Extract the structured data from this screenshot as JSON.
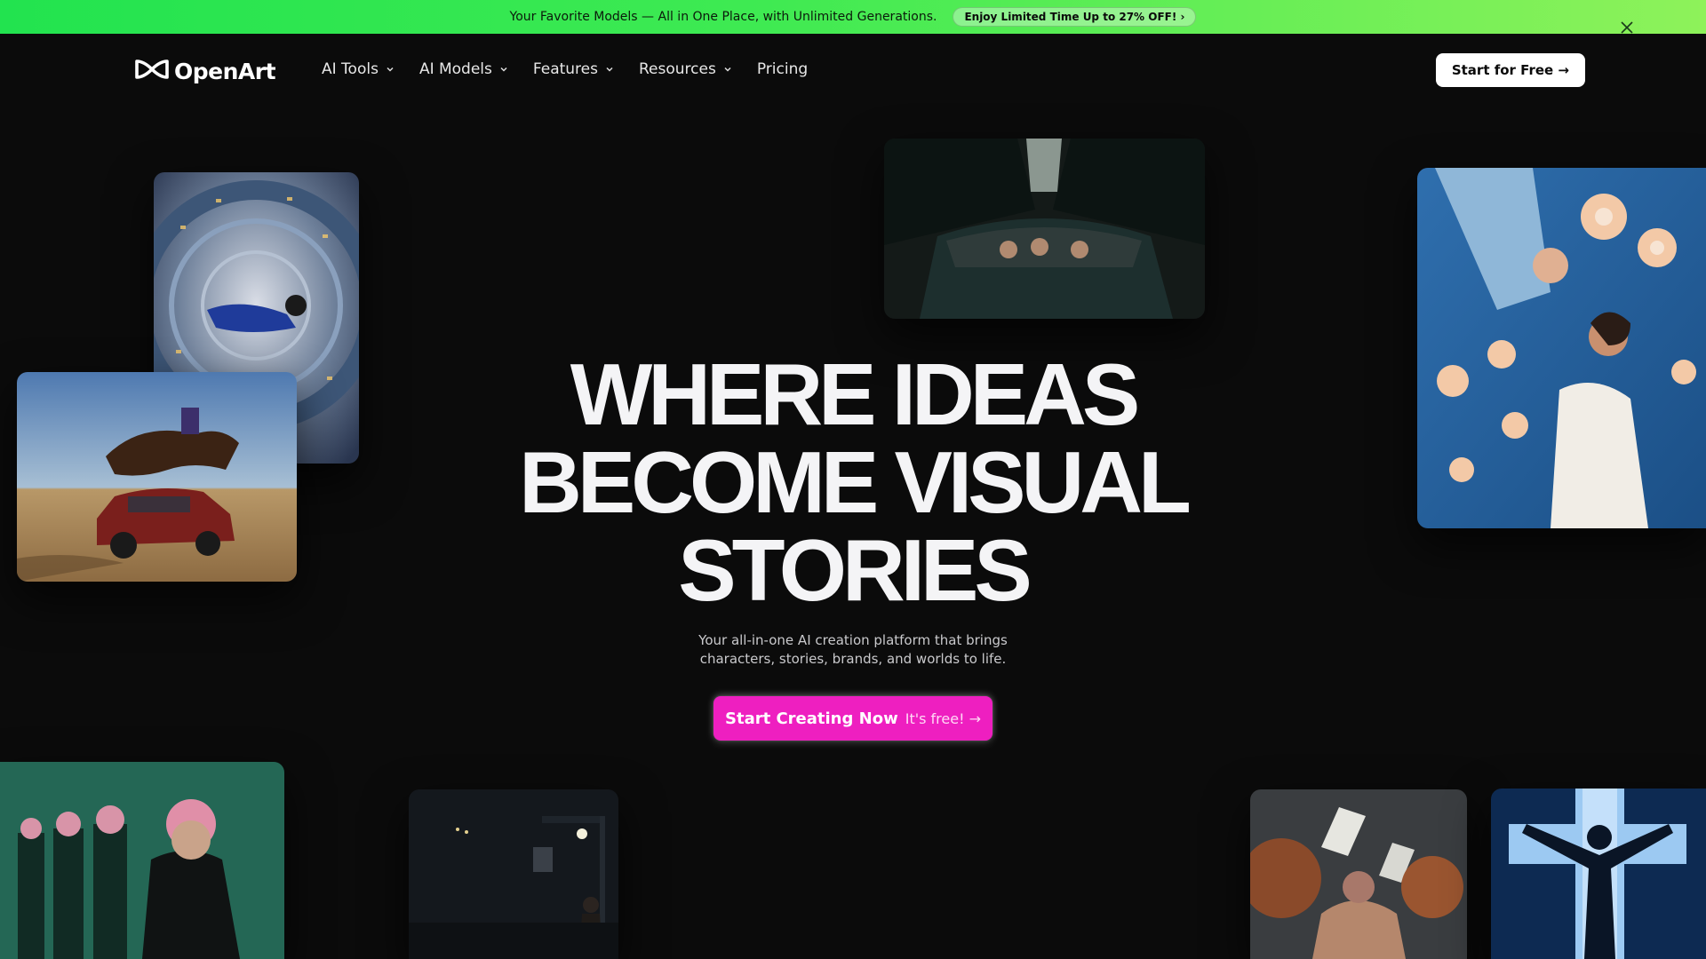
{
  "promo": {
    "message": "Your Favorite Models — All in One Place, with Unlimited Generations.",
    "offer": "Enjoy Limited Time Up to 27% OFF! ›"
  },
  "nav": {
    "logo_text": "OpenArt",
    "items": [
      {
        "label": "AI Tools",
        "has_dropdown": true
      },
      {
        "label": "AI Models",
        "has_dropdown": true
      },
      {
        "label": "Features",
        "has_dropdown": true
      },
      {
        "label": "Resources",
        "has_dropdown": true
      },
      {
        "label": "Pricing",
        "has_dropdown": false
      }
    ],
    "cta": "Start for Free →"
  },
  "hero": {
    "title_lines": [
      "WHERE IDEAS",
      "BECOME VISUAL",
      "STORIES"
    ],
    "subtitle_lines": [
      "Your all-in-one AI creation platform that brings",
      "characters, stories, brands, and worlds to life."
    ],
    "cta_label": "Start Creating Now",
    "cta_sub": "It's free! →"
  },
  "colors": {
    "accent": "#ee1fc0",
    "banner": "#3fea52",
    "background": "#0b0b0b"
  }
}
